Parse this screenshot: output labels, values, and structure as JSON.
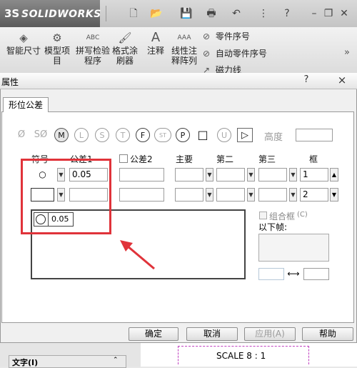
{
  "app": {
    "logo_text": "SOLIDWORKS",
    "logo_mark": "3S"
  },
  "ribbon": {
    "smart_dimension": "智能尺寸",
    "model_items": "模型项目",
    "spell_checker": "拼写检验程序",
    "format_painter": "格式涂刷器",
    "note": "注释",
    "linear_note_pattern": "线性注释阵列",
    "balloon": "零件序号",
    "auto_balloon": "自动零件序号",
    "magnetic_line": "磁力线"
  },
  "dialog": {
    "title": "属性",
    "help_icon": "?",
    "close_icon": "×",
    "tab": "形位公差",
    "height_label": "高度",
    "headers": {
      "symbol": "符号",
      "tolerance1": "公差1",
      "tolerance2": "公差2",
      "primary": "主要",
      "secondary": "第二",
      "tertiary": "第三",
      "frame": "框"
    },
    "row1": {
      "symbol": "○",
      "tolerance1": "0.05",
      "frame": "1"
    },
    "row2": {
      "frame": "2"
    },
    "preview_value": "0.05",
    "composite_frame": "组合框",
    "composite_key": "(C)",
    "below_frame": "以下帧:",
    "buttons": {
      "ok": "确定",
      "cancel": "取消",
      "apply": "应用(A)",
      "help": "帮助"
    }
  },
  "modifiers": [
    "Ø",
    "SØ",
    "M",
    "L",
    "S",
    "T",
    "F",
    "ST",
    "P",
    "□",
    "U",
    "▷"
  ],
  "bottom": {
    "text_panel": "文字(I)",
    "scale_text": "SCALE 8 : 1"
  },
  "colors": {
    "highlight": "#e0333a",
    "ribbon_bg": "#e8e8e8"
  }
}
